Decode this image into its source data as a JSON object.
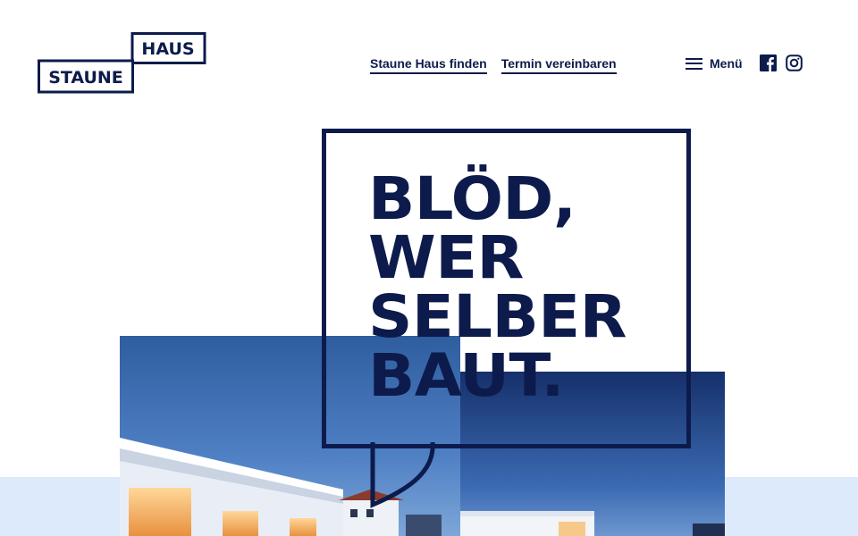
{
  "header": {
    "logo": {
      "word_top": "HAUS",
      "word_bottom": "STAUNE"
    },
    "nav": [
      {
        "label": "Staune Haus finden"
      },
      {
        "label": "Termin vereinbaren"
      }
    ],
    "menu_label": "Menü",
    "social": [
      {
        "icon": "facebook-icon"
      },
      {
        "icon": "instagram-icon"
      }
    ]
  },
  "hero": {
    "headline_lines": [
      "BLÖD,",
      "WER",
      "SELBER",
      "BAUT."
    ]
  },
  "colors": {
    "brand_navy": "#0d1b4c",
    "band_light_blue": "#ddeafb",
    "sky_blue": "#3b6ab3"
  }
}
